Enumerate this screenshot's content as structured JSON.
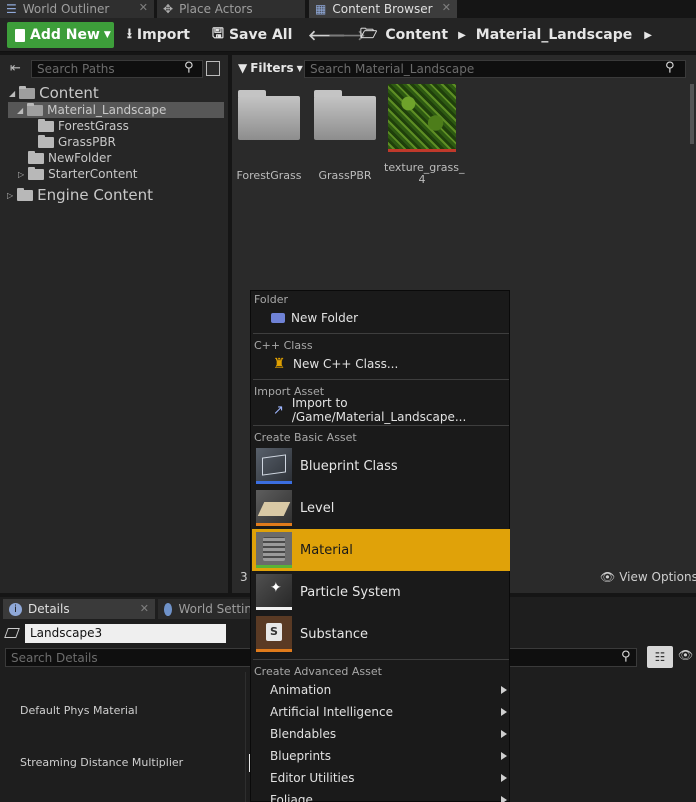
{
  "tabs": [
    {
      "label": "World Outliner",
      "icon": "world-outliner-icon",
      "active": false
    },
    {
      "label": "Place Actors",
      "icon": "place-actors-icon",
      "active": false
    },
    {
      "label": "Content Browser",
      "icon": "content-browser-icon",
      "active": true
    }
  ],
  "toolbar": {
    "add_new": "Add New",
    "import": "Import",
    "save_all": "Save All",
    "crumbs": [
      "Content",
      "Material_Landscape"
    ]
  },
  "sources": {
    "search_placeholder": "Search Paths",
    "tree": [
      {
        "label": "Content",
        "level": 0,
        "large": true
      },
      {
        "label": "Material_Landscape",
        "level": 1,
        "selected": true
      },
      {
        "label": "ForestGrass",
        "level": 2
      },
      {
        "label": "GrassPBR",
        "level": 2
      },
      {
        "label": "NewFolder",
        "level": 1
      },
      {
        "label": "StarterContent",
        "level": 1
      },
      {
        "label": "Engine Content",
        "level": 0,
        "large": true
      }
    ]
  },
  "assets_view": {
    "filters_label": "Filters",
    "search_placeholder": "Search Material_Landscape",
    "assets": [
      {
        "label": "ForestGrass",
        "kind": "folder"
      },
      {
        "label": "GrassPBR",
        "kind": "folder"
      },
      {
        "label": "texture_grass_\n4",
        "kind": "texture"
      }
    ],
    "item_count": "3",
    "view_options": "View Options"
  },
  "details": {
    "tabs": [
      {
        "label": "Details",
        "icon": "details-icon"
      },
      {
        "label": "World Settin",
        "icon": "globe-icon"
      }
    ],
    "object_name": "Landscape3",
    "search_placeholder": "Search Details",
    "properties": [
      "Default Phys Material",
      "Streaming Distance Multiplier"
    ]
  },
  "context_menu": {
    "sections": {
      "folder": "Folder",
      "cpp": "C++ Class",
      "import": "Import Asset",
      "basic": "Create Basic Asset",
      "advanced": "Create Advanced Asset"
    },
    "new_folder": "New Folder",
    "new_cpp": "New C++ Class...",
    "import_to": "Import to /Game/Material_Landscape...",
    "basic_assets": [
      {
        "label": "Blueprint Class",
        "bar_color": "#3b6ee0"
      },
      {
        "label": "Level",
        "bar_color": "#e07b1b"
      },
      {
        "label": "Material",
        "bar_color": "#5ab336",
        "highlighted": true
      },
      {
        "label": "Particle System",
        "bar_color": "#f2f2f2"
      },
      {
        "label": "Substance",
        "bar_color": "#e07b1b"
      }
    ],
    "advanced_assets": [
      "Animation",
      "Artificial Intelligence",
      "Blendables",
      "Blueprints",
      "Editor Utilities",
      "Foliage"
    ]
  },
  "colors": {
    "accent_green": "#3d9e3a",
    "highlight": "#e0a209"
  }
}
